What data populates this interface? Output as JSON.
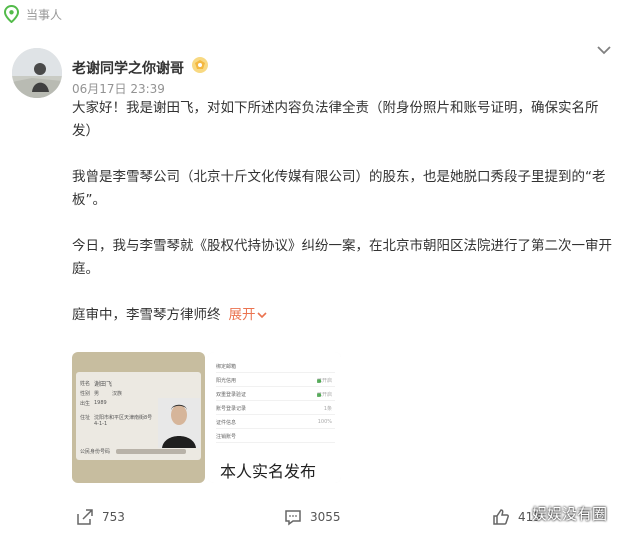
{
  "topic": {
    "label": "当事人"
  },
  "author": {
    "name": "老谢同学之你谢哥",
    "time": "06月17日 23:39"
  },
  "post": {
    "paragraphs": [
      "大家好！我是谢田飞，对如下所述内容负法律全责（附身份照片和账号证明，确保实名所发）",
      "我曾是李雪琴公司（北京十斤文化传媒有限公司）的股东，也是她脱口秀段子里提到的“老板”。",
      "今日，我与李雪琴就《股权代持协议》纠纷一案，在北京市朝阳区法院进行了第二次一审开庭。"
    ],
    "truncated": "庭审中，李雪琴方律师终",
    "expand_label": "展开"
  },
  "images": {
    "idcard": {
      "name_label": "姓名",
      "name": "谢田飞",
      "sex_label": "性别",
      "sex": "男",
      "ethnicity": "汉族",
      "birth_label": "出生",
      "birth": "1989",
      "address_label": "住址",
      "address": "沈阳市和平区天津南街8号",
      "address2": "4-1-1",
      "id_label": "公民身份号码"
    },
    "account": {
      "rows": [
        {
          "label": "绑定邮箱",
          "value": ""
        },
        {
          "label": "阳光信用",
          "value": "已开启"
        },
        {
          "label": "双重登录验证",
          "value": "已开启"
        },
        {
          "label": "账号登录记录",
          "value": "1条"
        },
        {
          "label": "证件信息",
          "value": "100%"
        },
        {
          "label": "注销账号",
          "value": ""
        }
      ],
      "caption": "本人实名发布"
    }
  },
  "actions": {
    "share": "753",
    "comment": "3055",
    "like": "413"
  },
  "watermark": "娱娱没有圈",
  "colors": {
    "accent": "#eb7350",
    "text": "#333333",
    "meta": "#939393",
    "badge": "#f4b840"
  }
}
